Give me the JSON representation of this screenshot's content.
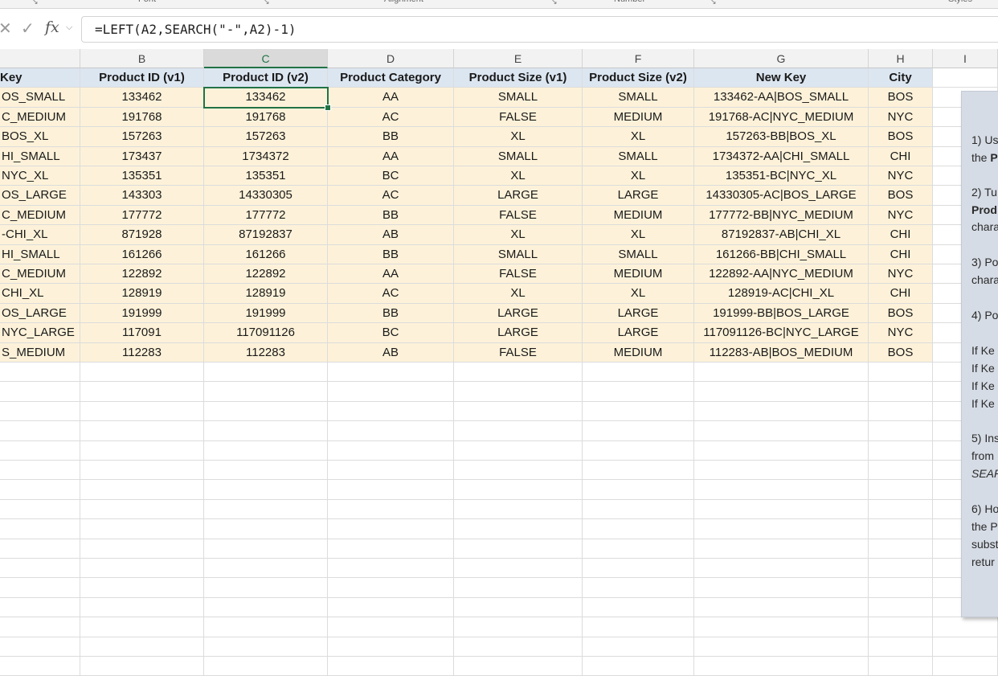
{
  "ribbon": {
    "groups": [
      "Font",
      "Alignment",
      "Number",
      "Styles"
    ]
  },
  "formula_bar": {
    "cancel_icon": "close-icon",
    "enter_icon": "check-icon",
    "fx_label": "fx",
    "formula": "=LEFT(A2,SEARCH(\"-\",A2)-1)"
  },
  "columns": [
    "B",
    "C",
    "D",
    "E",
    "F",
    "G",
    "H",
    "I"
  ],
  "selected_cell": "C2",
  "table": {
    "headers": [
      "Key",
      "Product ID (v1)",
      "Product ID (v2)",
      "Product Category",
      "Product Size (v1)",
      "Product Size (v2)",
      "New Key",
      "City"
    ],
    "rows": [
      [
        "OS_SMALL",
        "133462",
        "133462",
        "AA",
        "SMALL",
        "SMALL",
        "133462-AA|BOS_SMALL",
        "BOS"
      ],
      [
        "C_MEDIUM",
        "191768",
        "191768",
        "AC",
        "FALSE",
        "MEDIUM",
        "191768-AC|NYC_MEDIUM",
        "NYC"
      ],
      [
        "BOS_XL",
        "157263",
        "157263",
        "BB",
        "XL",
        "XL",
        "157263-BB|BOS_XL",
        "BOS"
      ],
      [
        "HI_SMALL",
        "173437",
        "1734372",
        "AA",
        "SMALL",
        "SMALL",
        "1734372-AA|CHI_SMALL",
        "CHI"
      ],
      [
        "NYC_XL",
        "135351",
        "135351",
        "BC",
        "XL",
        "XL",
        "135351-BC|NYC_XL",
        "NYC"
      ],
      [
        "OS_LARGE",
        "143303",
        "14330305",
        "AC",
        "LARGE",
        "LARGE",
        "14330305-AC|BOS_LARGE",
        "BOS"
      ],
      [
        "C_MEDIUM",
        "177772",
        "177772",
        "BB",
        "FALSE",
        "MEDIUM",
        "177772-BB|NYC_MEDIUM",
        "NYC"
      ],
      [
        "-CHI_XL",
        "871928",
        "87192837",
        "AB",
        "XL",
        "XL",
        "87192837-AB|CHI_XL",
        "CHI"
      ],
      [
        "HI_SMALL",
        "161266",
        "161266",
        "BB",
        "SMALL",
        "SMALL",
        "161266-BB|CHI_SMALL",
        "CHI"
      ],
      [
        "C_MEDIUM",
        "122892",
        "122892",
        "AA",
        "FALSE",
        "MEDIUM",
        "122892-AA|NYC_MEDIUM",
        "NYC"
      ],
      [
        "CHI_XL",
        "128919",
        "128919",
        "AC",
        "XL",
        "XL",
        "128919-AC|CHI_XL",
        "CHI"
      ],
      [
        "OS_LARGE",
        "191999",
        "191999",
        "BB",
        "LARGE",
        "LARGE",
        "191999-BB|BOS_LARGE",
        "BOS"
      ],
      [
        "NYC_LARGE",
        "117091",
        "117091126",
        "BC",
        "LARGE",
        "LARGE",
        "117091126-BC|NYC_LARGE",
        "NYC"
      ],
      [
        "S_MEDIUM",
        "112283",
        "112283",
        "AB",
        "FALSE",
        "MEDIUM",
        "112283-AB|BOS_MEDIUM",
        "BOS"
      ]
    ]
  },
  "instructions_panel": {
    "lines": [
      {
        "text": "1) Us",
        "style": ""
      },
      {
        "text": "the P",
        "style": "b-partial"
      },
      {
        "text": "2) Tu",
        "style": ""
      },
      {
        "text": "Prod",
        "style": "b"
      },
      {
        "text": "chara",
        "style": ""
      },
      {
        "text": "3) Po",
        "style": ""
      },
      {
        "text": "chara",
        "style": ""
      },
      {
        "text": "4) Po",
        "style": ""
      },
      {
        "text": "If Ke",
        "style": ""
      },
      {
        "text": "If Ke",
        "style": ""
      },
      {
        "text": "If Ke",
        "style": ""
      },
      {
        "text": "If Ke",
        "style": ""
      },
      {
        "text": "5) Ins",
        "style": ""
      },
      {
        "text": "from",
        "style": ""
      },
      {
        "text": "SEAR",
        "style": "i"
      },
      {
        "text": "6) Ho",
        "style": ""
      },
      {
        "text": "the P",
        "style": ""
      },
      {
        "text": "subst",
        "style": ""
      },
      {
        "text": "retur",
        "style": ""
      }
    ]
  }
}
